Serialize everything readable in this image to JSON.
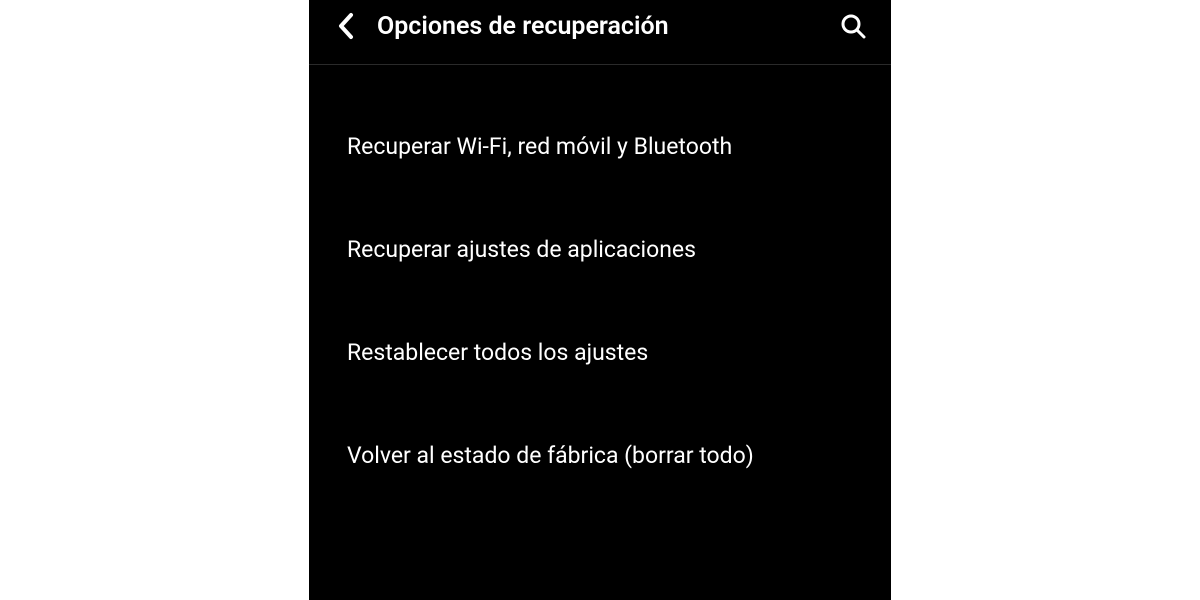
{
  "header": {
    "title": "Opciones de recuperación"
  },
  "options": [
    {
      "label": "Recuperar Wi-Fi, red móvil y Bluetooth"
    },
    {
      "label": "Recuperar ajustes de aplicaciones"
    },
    {
      "label": "Restablecer todos los ajustes"
    },
    {
      "label": "Volver al estado de fábrica (borrar todo)"
    }
  ]
}
